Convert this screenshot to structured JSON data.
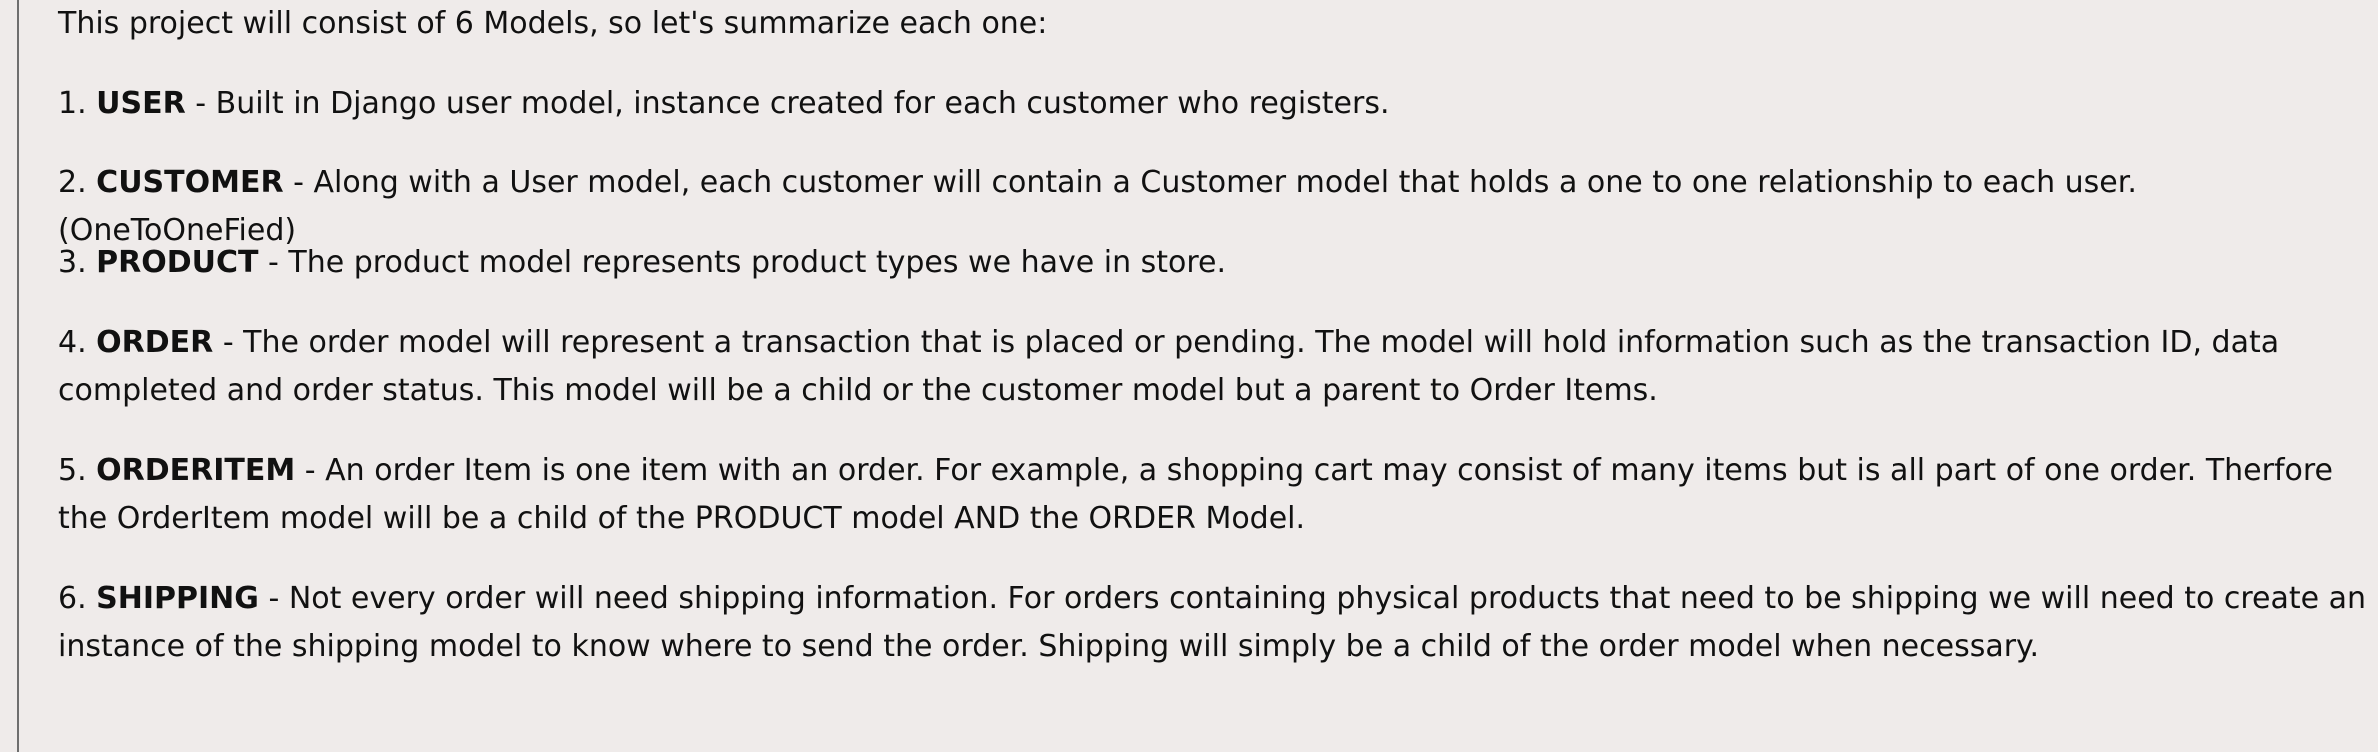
{
  "intro": "This project will consist of 6 Models, so let's summarize each one:",
  "items": [
    {
      "num": "1.",
      "term": "USER",
      "desc": " - Built in Django user model,  instance created for each customer who registers."
    },
    {
      "num": "2.",
      "term": "CUSTOMER",
      "desc": " - Along with a User model, each customer will contain a Customer model that holds a one to one relationship to each user. (OneToOneFied)"
    },
    {
      "num": "3.",
      "term": "PRODUCT",
      "desc": " - The product model represents product types we have in store."
    },
    {
      "num": "4.",
      "term": "ORDER",
      "desc": " - The order model will represent a transaction that is placed or pending. The model will hold information such as the transaction ID, data completed and order status. This model will be a child or the customer model but a parent to Order Items."
    },
    {
      "num": "5.",
      "term": "ORDERITEM",
      "desc": " - An order Item is one item with an order. For example, a shopping cart may consist of many items but is all part of one order. Therfore the OrderItem model will be a child of the PRODUCT model AND the ORDER Model."
    },
    {
      "num": "6.",
      "term": "SHIPPING",
      "desc": " - Not every order will need shipping information. For orders containing physical products that need to be shipping we will need to create an instance of the shipping model to know where to send the order. Shipping will simply be a child of the order model when necessary."
    }
  ]
}
